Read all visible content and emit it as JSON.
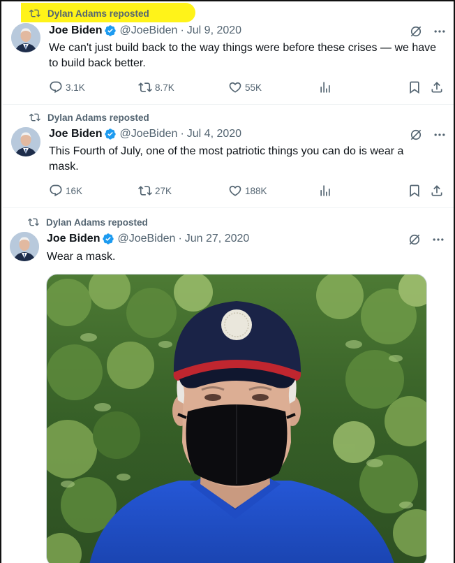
{
  "tweets": [
    {
      "reposted_by": "Dylan Adams reposted",
      "name": "Joe Biden",
      "handle": "@JoeBiden",
      "separator": "·",
      "date": "Jul 9, 2020",
      "text": "We can't just build back to the way things were before these crises — we have to build back better.",
      "replies": "3.1K",
      "reposts": "8.7K",
      "likes": "55K"
    },
    {
      "reposted_by": "Dylan Adams reposted",
      "name": "Joe Biden",
      "handle": "@JoeBiden",
      "separator": "·",
      "date": "Jul 4, 2020",
      "text": "This Fourth of July, one of the most patriotic things you can do is wear a mask.",
      "replies": "16K",
      "reposts": "27K",
      "likes": "188K"
    },
    {
      "reposted_by": "Dylan Adams reposted",
      "name": "Joe Biden",
      "handle": "@JoeBiden",
      "separator": "·",
      "date": "Jun 27, 2020",
      "text": "Wear a mask."
    }
  ],
  "icons": {
    "repost": "repost-icon",
    "verified": "verified-badge-icon",
    "grok": "grok-icon",
    "more": "more-icon",
    "reply": "reply-icon",
    "like": "heart-icon",
    "views": "views-icon",
    "bookmark": "bookmark-icon",
    "share": "share-icon"
  },
  "colors": {
    "highlight": "#fff200",
    "verified": "#1d9bf0",
    "muted": "#536471",
    "text": "#0f1419"
  }
}
